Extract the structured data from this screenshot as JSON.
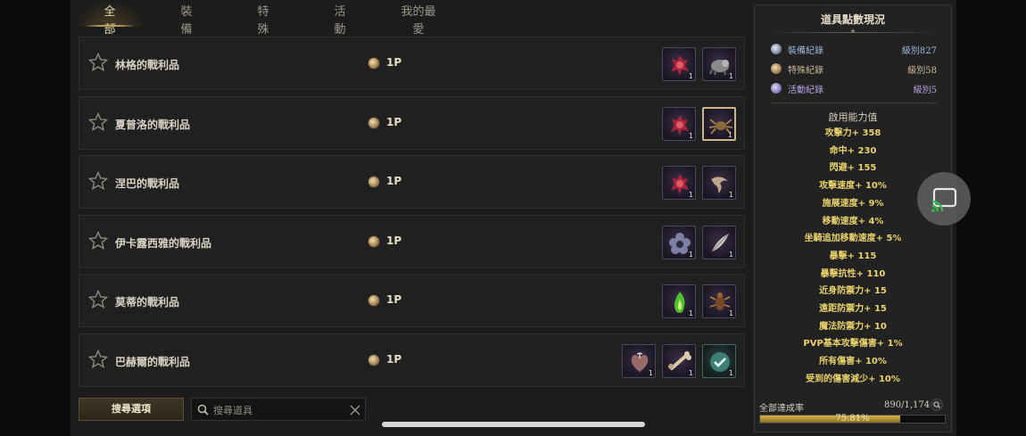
{
  "tabs": [
    {
      "label": "全部",
      "active": true
    },
    {
      "label": "裝備",
      "active": false
    },
    {
      "label": "特殊",
      "active": false
    },
    {
      "label": "活動",
      "active": false
    },
    {
      "label": "我的最愛",
      "active": false
    }
  ],
  "rows": [
    {
      "name": "林格的戰利品",
      "points": "1P",
      "items": [
        {
          "icon": "red-creature-icon",
          "qty": "1"
        },
        {
          "icon": "gray-beast-icon",
          "qty": "1"
        }
      ]
    },
    {
      "name": "夏普洛的戰利品",
      "points": "1P",
      "items": [
        {
          "icon": "red-creature-icon",
          "qty": "1"
        },
        {
          "icon": "spider-icon",
          "qty": "1"
        }
      ]
    },
    {
      "name": "涅巴的戰利品",
      "points": "1P",
      "items": [
        {
          "icon": "red-creature-icon",
          "qty": "1"
        },
        {
          "icon": "claw-icon",
          "qty": "1"
        }
      ]
    },
    {
      "name": "伊卡露西雅的戰利品",
      "points": "1P",
      "items": [
        {
          "icon": "dark-flower-icon",
          "qty": "1"
        },
        {
          "icon": "feather-icon",
          "qty": "1"
        }
      ]
    },
    {
      "name": "莫蒂的戰利品",
      "points": "1P",
      "items": [
        {
          "icon": "green-flame-icon",
          "qty": "1"
        },
        {
          "icon": "brown-insect-icon",
          "qty": "1"
        }
      ]
    },
    {
      "name": "巴赫爾的戰利品",
      "points": "1P",
      "items": [
        {
          "icon": "red-heart-icon",
          "qty": "1"
        },
        {
          "icon": "bone-icon",
          "qty": "1"
        },
        {
          "icon": "check-icon",
          "qty": "1"
        }
      ]
    }
  ],
  "bottom": {
    "search_options_label": "搜尋選項",
    "search_placeholder": "搜尋道具"
  },
  "summary": {
    "title": "道具點數現況",
    "records": [
      {
        "label": "裝備紀錄",
        "level": "級別827",
        "color": "#9fb6d8"
      },
      {
        "label": "特殊紀錄",
        "level": "級別58",
        "color": "#cbb898"
      },
      {
        "label": "活動紀錄",
        "level": "級別5",
        "color": "#b6a2e8"
      }
    ],
    "stats_title": "啟用能力值",
    "stats": [
      "攻擊力+ 358",
      "命中+ 230",
      "閃避+ 155",
      "攻擊速度+ 10%",
      "施展速度+ 9%",
      "移動速度+ 4%",
      "坐騎追加移動速度+ 5%",
      "暴擊+ 115",
      "暴擊抗性+ 110",
      "近身防禦力+ 15",
      "遠距防禦力+ 15",
      "魔法防禦力+ 10",
      "PVP基本攻擊傷害+ 1%",
      "所有傷害+ 10%",
      "受到的傷害減少+ 10%"
    ],
    "total_label": "全部達成率",
    "total_value": "890/1,174",
    "percent_label": "75.81%",
    "percent": 75.81
  }
}
